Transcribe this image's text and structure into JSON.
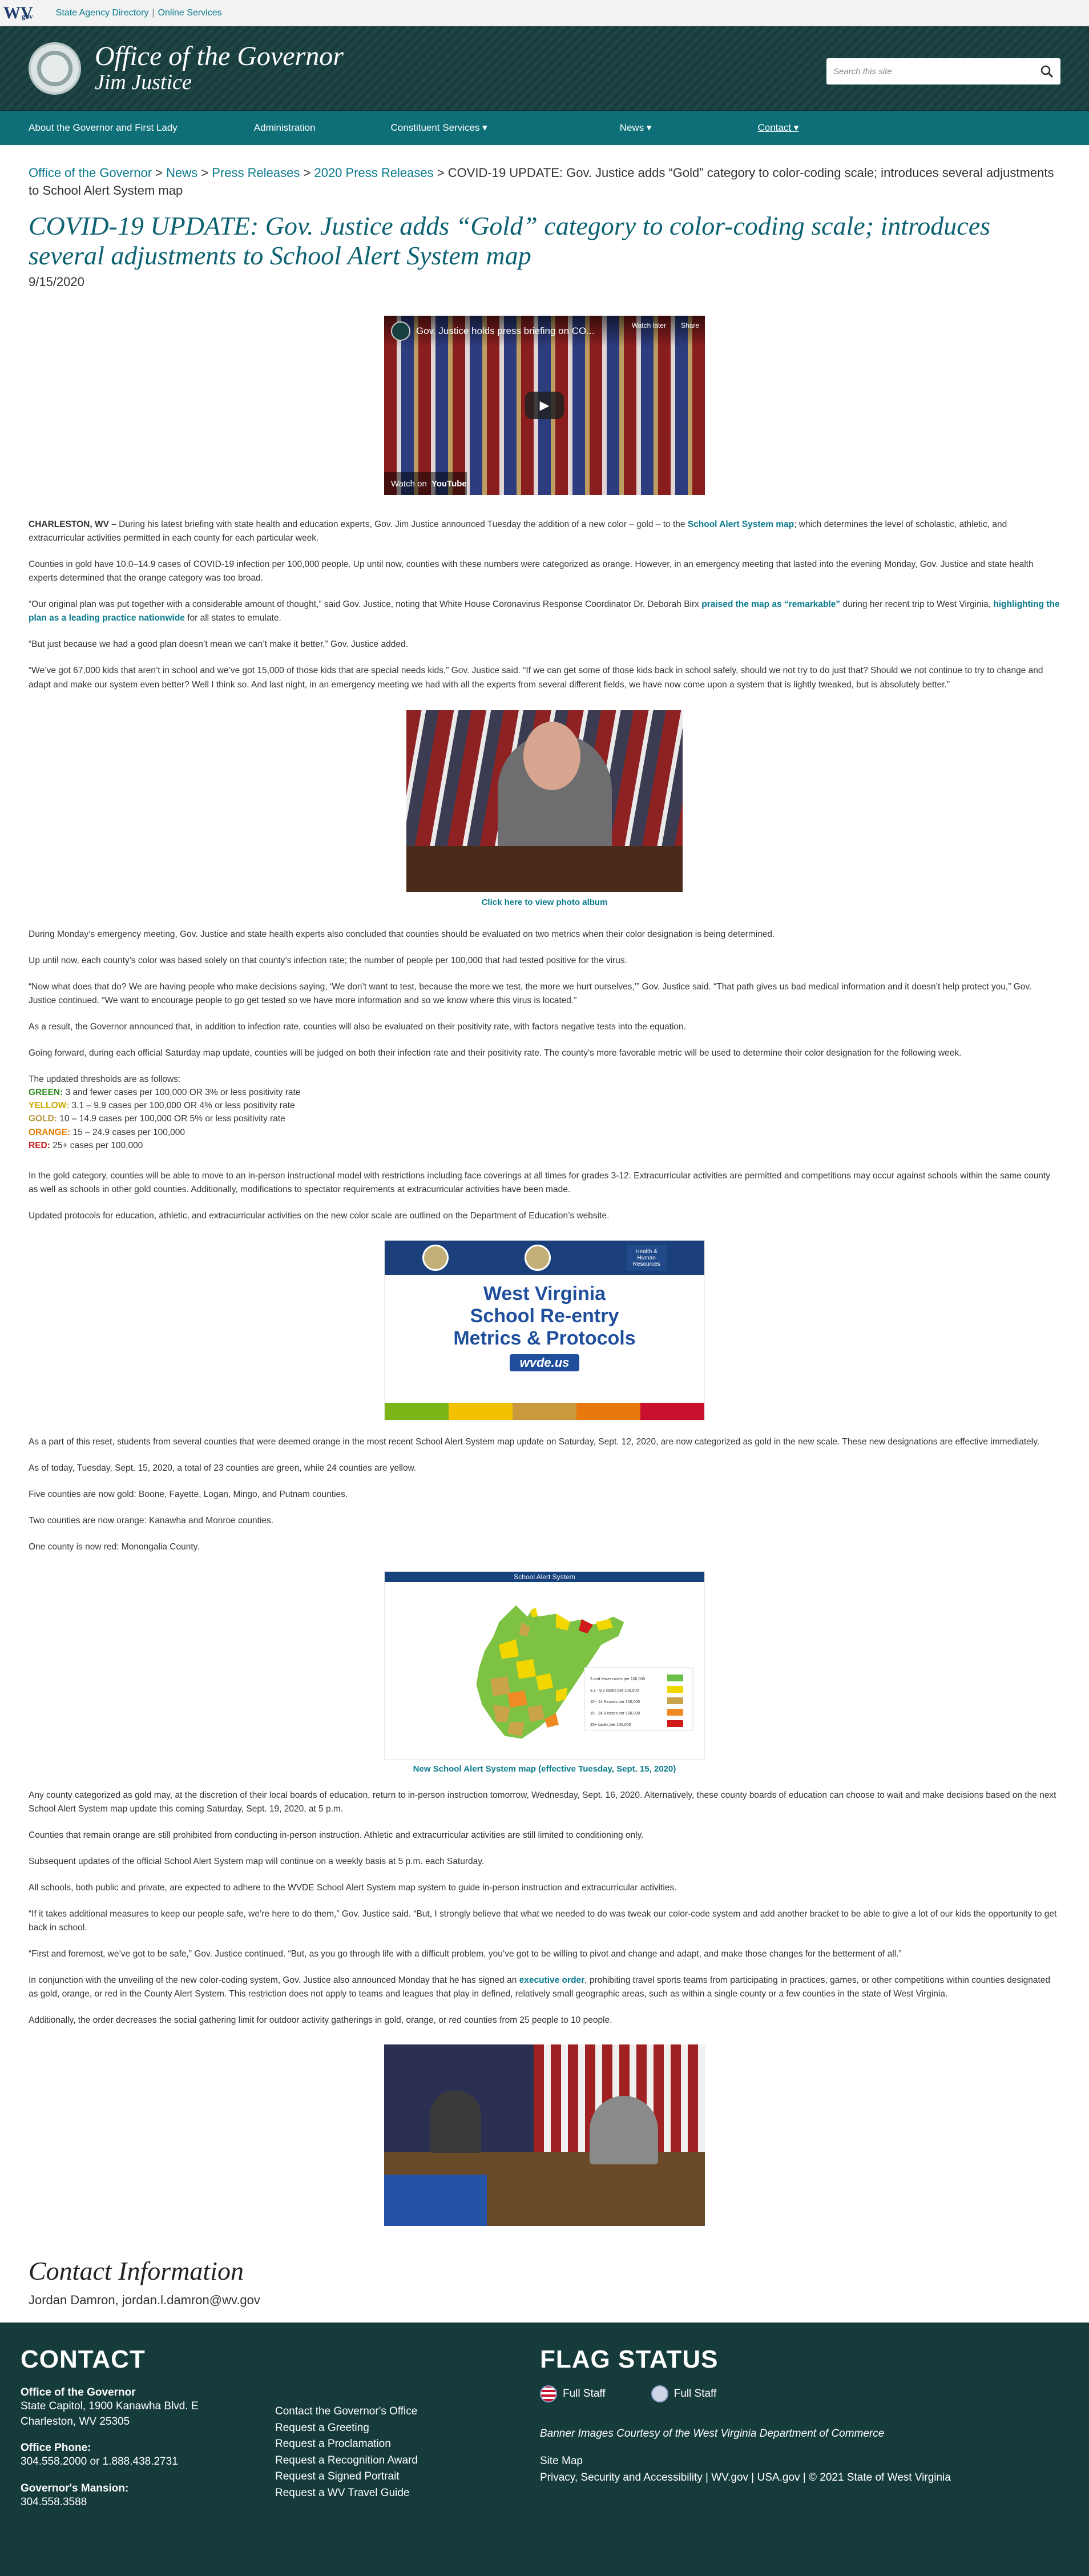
{
  "topbar": {
    "logo": "WV",
    "logo_sub": "gov",
    "links": [
      "State Agency Directory",
      "Online Services"
    ],
    "sep": "|"
  },
  "header": {
    "title_line1": "Office of the Governor",
    "title_line2": "Jim Justice",
    "search_placeholder": "Search this site"
  },
  "nav": {
    "items": [
      "About the Governor and First Lady",
      "Administration",
      "Constituent Services ▾",
      "News ▾",
      "Contact ▾"
    ]
  },
  "breadcrumb": {
    "items": [
      "Office of the Governor",
      "News",
      "Press Releases",
      "2020 Press Releases"
    ],
    "current": "COVID-19 UPDATE: Gov. Justice adds “Gold” category to color-coding scale; introduces several adjustments to School Alert System map",
    "sep": ">"
  },
  "article": {
    "title": "COVID-19 UPDATE: Gov. Justice adds “Gold” category to color-coding scale; introduces several adjustments to School Alert System map",
    "date": "9/15/2020",
    "video": {
      "title": "Gov. Justice holds press briefing on CO...",
      "watch_later": "Watch later",
      "share": "Share",
      "watch_on": "Watch on",
      "youtube": "YouTube"
    },
    "p1_lead": "CHARLESTON, WV –",
    "p1_a": " During his latest briefing with state health and education experts, Gov. Jim Justice announced Tuesday the addition of a new color – gold – to the ",
    "p1_link": "School Alert System map",
    "p1_b": "; which determines the level of scholastic, athletic, and extracurricular activities permitted in each county for each particular week.",
    "p2": "Counties in gold have 10.0–14.9 cases of COVID-19 infection per 100,000 people. Up until now, counties with these numbers were categorized as orange. However, in an emergency meeting that lasted into the evening Monday, Gov. Justice and state health experts determined that the orange category was too broad.",
    "p3_a": "“Our original plan was put together with a considerable amount of thought,” said Gov. Justice, noting that White House Coronavirus Response Coordinator Dr. Deborah Birx ",
    "p3_link1": "praised the map as “remarkable”",
    "p3_b": " during her recent trip to West Virginia, ",
    "p3_link2": "highlighting the plan as a leading practice nationwide",
    "p3_c": " for all states to emulate.",
    "p4": "“But just because we had a good plan doesn’t mean we can’t make it better,” Gov. Justice added.",
    "p5": "“We’ve got 67,000 kids that aren’t in school and we’ve got 15,000 of those kids that are special needs kids,” Gov. Justice said. “If we can get some of those kids back in school safely, should we not try to do just that? Should we not continue to try to change and adapt and make our system even better? Well I think so. And last night, in an emergency meeting we had with all the experts from several different fields, we have now come upon a system that is lightly tweaked, but is absolutely better.”",
    "photo_caption": "Click here to view photo album",
    "p6": "During Monday’s emergency meeting, Gov. Justice and state health experts also concluded that counties should be evaluated on two metrics when their color designation is being determined.",
    "p7": "Up until now, each county’s color was based solely on that county’s infection rate; the number of people per 100,000 that had tested positive for the virus.",
    "p8": "“Now what does that do? We are having people who make decisions saying, ‘We don’t want to test, because the more we test, the more we hurt ourselves,’” Gov. Justice said. “That path gives us bad medical information and it doesn’t help protect you,” Gov. Justice continued. “We want to encourage people to go get tested so we have more information and so we know where this virus is located.”",
    "p9": "As a result, the Governor announced that, in addition to infection rate, counties will also be evaluated on their positivity rate, with factors negative tests into the equation.",
    "p10": "Going forward, during each official Saturday map update, counties will be judged on both their infection rate and their positivity rate. The county’s more favorable metric will be used to determine their color designation for the following week.",
    "thresholds_intro": "The updated thresholds are as follows:",
    "thresholds": [
      {
        "label": "GREEN:",
        "text": " 3 and fewer cases per 100,000 OR 3% or less positivity rate",
        "color": "#2e8b1e"
      },
      {
        "label": "YELLOW:",
        "text": " 3.1 – 9.9 cases per 100,000 OR 4% or less positivity rate",
        "color": "#c9a800"
      },
      {
        "label": "GOLD:",
        "text": " 10 – 14.9 cases per 100,000 OR 5% or less positivity rate",
        "color": "#b8963a"
      },
      {
        "label": "ORANGE:",
        "text": " 15 – 24.9 cases per 100,000",
        "color": "#e07b00"
      },
      {
        "label": "RED:",
        "text": " 25+ cases per 100,000",
        "color": "#d11a1a"
      }
    ],
    "p11": "In the gold category, counties will be able to move to an in-person instructional model with restrictions including face coverings at all times for grades 3-12. Extracurricular activities are permitted and competitions may occur against schools within the same county as well as schools in other gold counties. Additionally, modifications to spectator requirements at extracurricular activities have been made.",
    "p12": "Updated protocols for education, athletic, and extracurricular activities on the new color scale are outlined on the Department of Education’s website.",
    "banner": {
      "line1": "West Virginia",
      "line2": "School Re-entry",
      "line3": "Metrics & Protocols",
      "site": "wvde.us",
      "hhr": "Health & Human Resources",
      "stripe_colors": [
        "#7cb518",
        "#f2c200",
        "#c99a3b",
        "#e8770e",
        "#c8102e"
      ]
    },
    "p13": "As a part of this reset, students from several counties that were deemed orange in the most recent School Alert System map update on Saturday, Sept. 12, 2020, are now categorized as gold in the new scale. These new designations are effective immediately.",
    "p14": "As of today, Tuesday, Sept. 15, 2020, a total of 23 counties are green, while 24 counties are yellow.",
    "p15": "Five counties are now gold: Boone, Fayette, Logan, Mingo, and Putnam counties.",
    "p16": "Two counties are now orange: Kanawha and Monroe counties.",
    "p17": "One county is now red: Monongalia County.",
    "map": {
      "header": "School Alert System",
      "legend": [
        {
          "text": "3 and fewer cases per 100,000",
          "color": "#6cc04a"
        },
        {
          "text": "3.1 - 9.9 cases per 100,000",
          "color": "#f2d600"
        },
        {
          "text": "10 - 14.9 cases per 100,000",
          "color": "#c9a44a"
        },
        {
          "text": "15 - 24.9 cases per 100,000",
          "color": "#f08a24"
        },
        {
          "text": "25+ cases per 100,000",
          "color": "#d11a1a"
        }
      ],
      "caption": "New School Alert System map (effective Tuesday, Sept. 15, 2020)"
    },
    "p18": "Any county categorized as gold may, at the discretion of their local boards of education, return to in-person instruction tomorrow, Wednesday, Sept. 16, 2020. Alternatively, these county boards of education can choose to wait and make decisions based on the next School Alert System map update this coming Saturday, Sept. 19, 2020, at 5 p.m.",
    "p19": "Counties that remain orange are still prohibited from conducting in-person instruction. Athletic and extracurricular activities are still limited to conditioning only.",
    "p20": "Subsequent updates of the official School Alert System map will continue on a weekly basis at 5 p.m. each Saturday.",
    "p21": "All schools, both public and private, are expected to adhere to the WVDE School Alert System map system to guide in-person instruction and extracurricular activities.",
    "p22": "“If it takes additional measures to keep our people safe, we’re here to do them,” Gov. Justice said. “But, I strongly believe that what we needed to do was tweak our color-code system and add another bracket to be able to give a lot of our kids the opportunity to get back in school.",
    "p23": "“First and foremost, we’ve got to be safe,” Gov. Justice continued. “But, as you go through life with a difficult problem, you’ve got to be willing to pivot and change and adapt, and make those changes for the betterment of all.”",
    "p24_a": "In conjunction with the unveiling of the new color-coding system, Gov. Justice also announced Monday that he has signed an ",
    "p24_link": "executive order",
    "p24_b": ", prohibiting travel sports teams from participating in practices, games, or other competitions within counties designated as gold, orange, or red in the County Alert System. This restriction does not apply to teams and leagues that play in defined, relatively small geographic areas, such as within a single county or a few counties in the state of West Virginia.",
    "p25": "Additionally, the order decreases the social gathering limit for outdoor activity gatherings in gold, orange, or red counties from 25 people to 10 people."
  },
  "contact_info": {
    "heading": "Contact Information",
    "name": "Jordan Damron",
    "email": "jordan.l.damron@wv.gov"
  },
  "footer": {
    "heading": "CONTACT",
    "office_label": "Office of the Governor",
    "address1": "State Capitol, 1900 Kanawha Blvd. E",
    "address2": "Charleston, WV 25305",
    "phone_label": "Office Phone:",
    "phone": "304.558.2000 or 1.888.438.2731",
    "mansion_label": "Governor's Mansion:",
    "mansion_phone": "304.558.3588",
    "links": [
      "Contact the Governor's Office",
      "Request a Greeting",
      "Request a Proclamation",
      "Request a Recognition Award",
      "Request a Signed Portrait",
      "Request a WV Travel Guide"
    ],
    "flag_heading": "FLAG STATUS",
    "flag_us": "Full Staff",
    "flag_wv": "Full Staff",
    "banner_credit": "Banner Images Courtesy of the West Virginia Department of Commerce",
    "site_map": "Site Map",
    "bottom_links": [
      "Privacy, Security and Accessibility",
      "WV.gov",
      "USA.gov",
      "© 2021 State of West Virginia"
    ]
  }
}
